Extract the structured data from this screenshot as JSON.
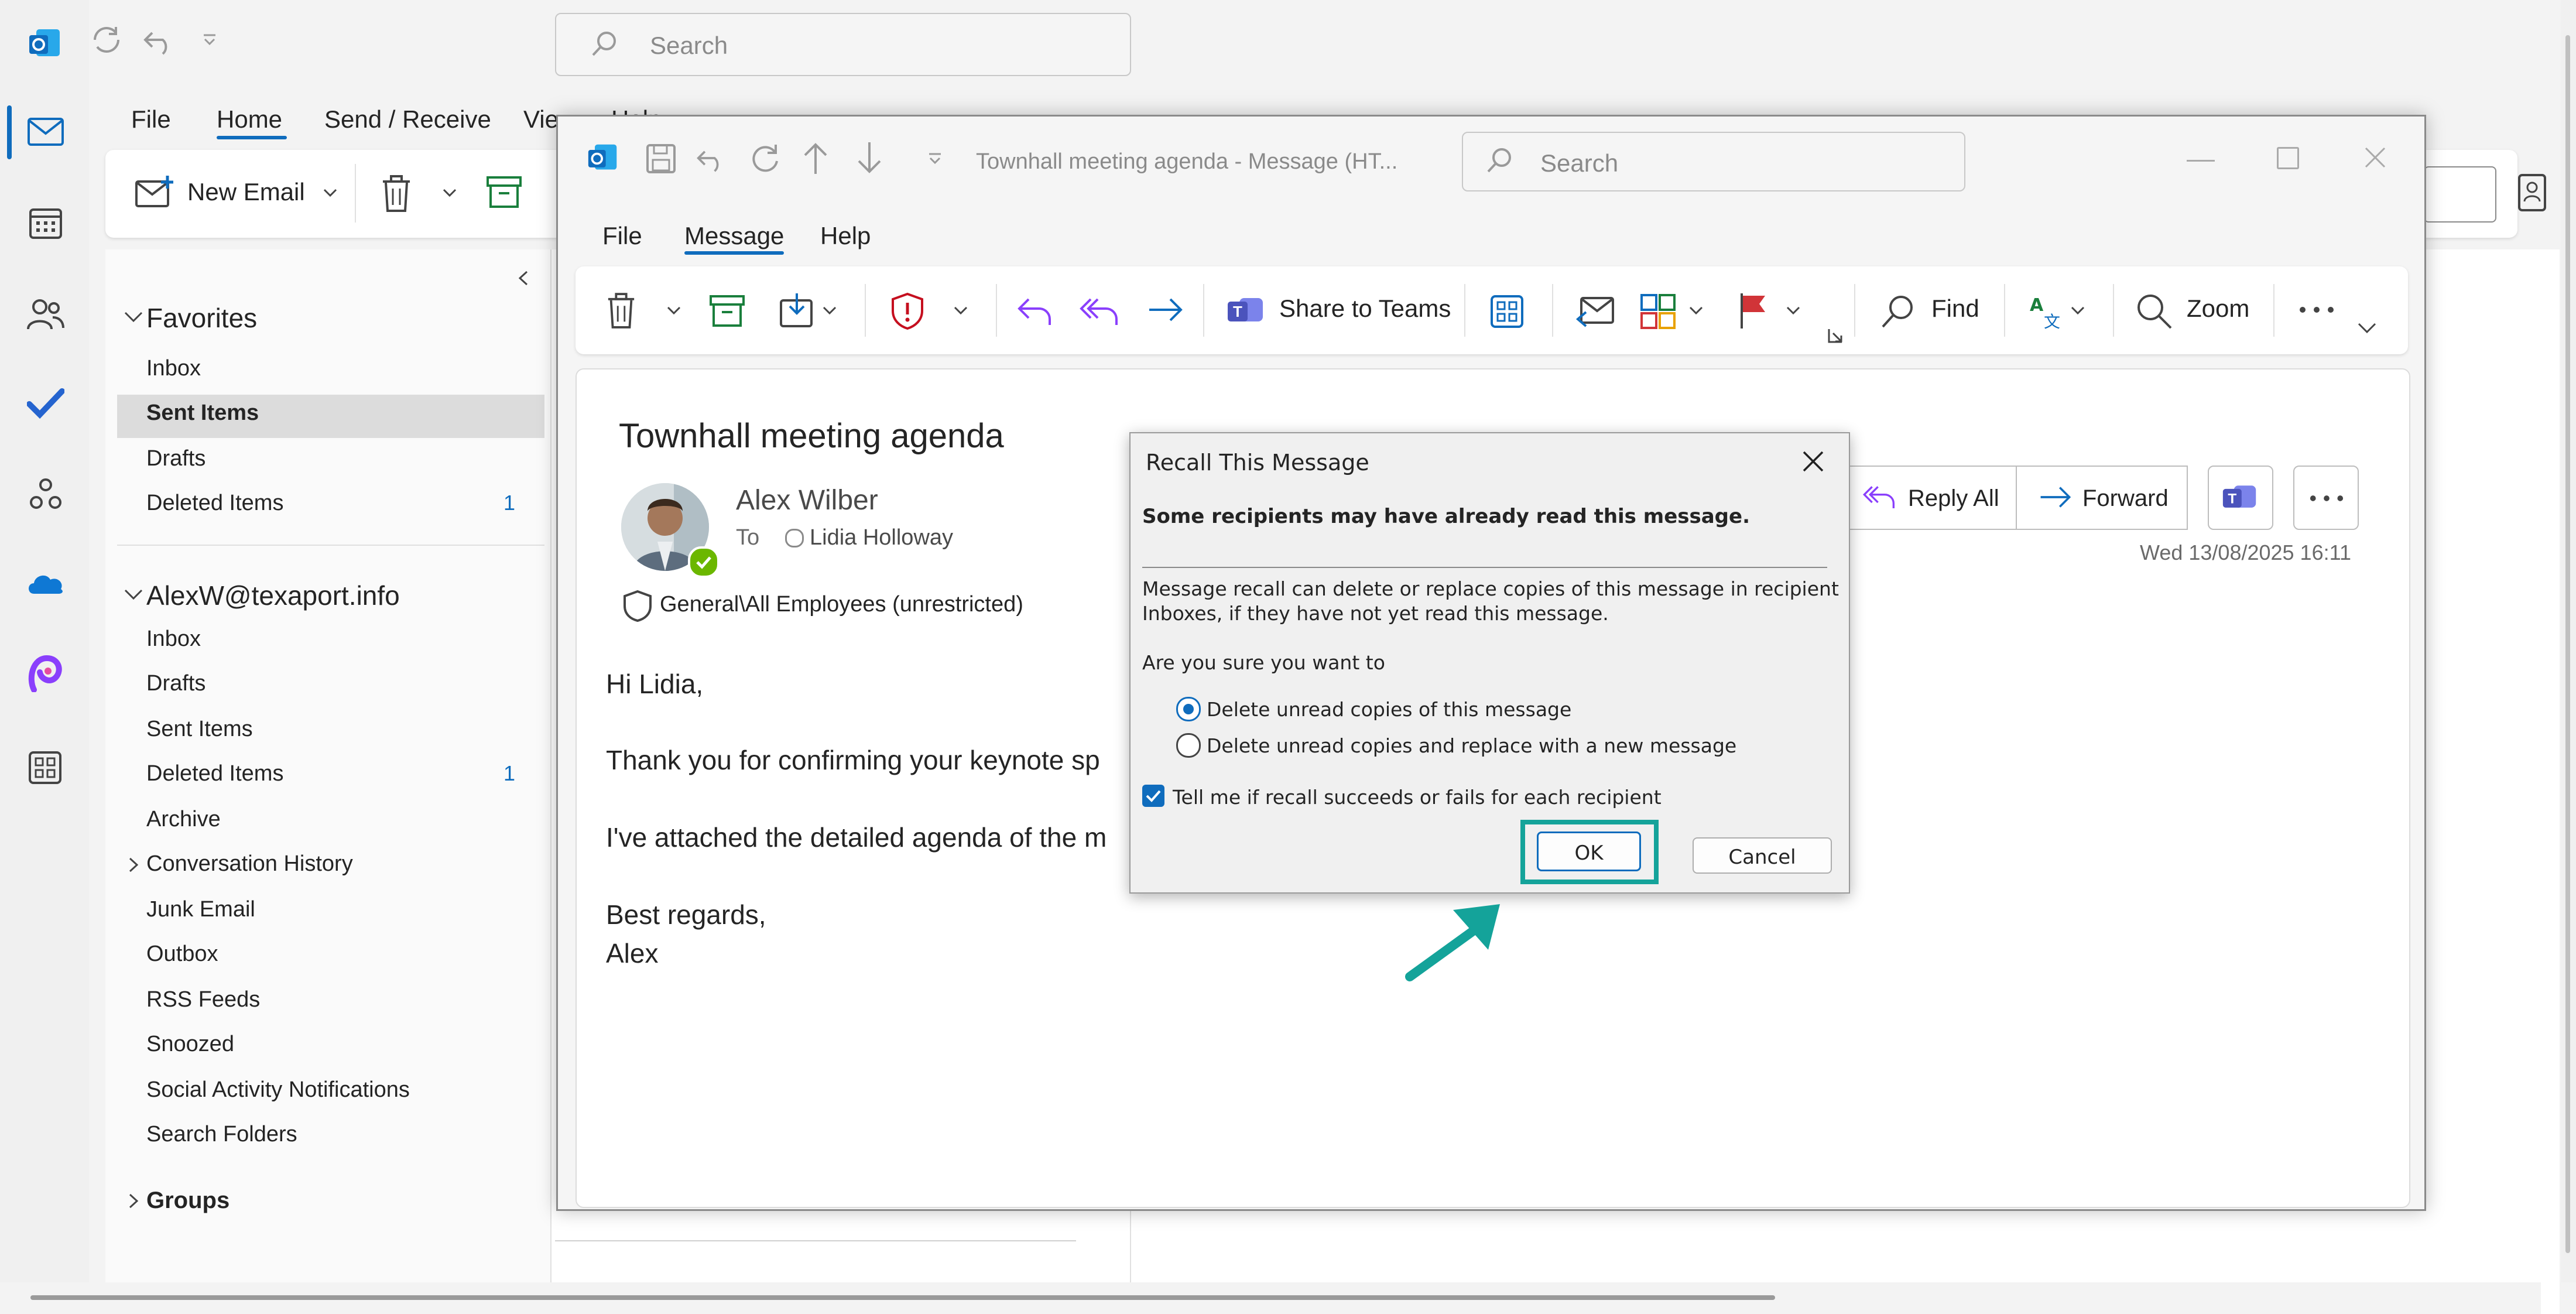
{
  "main_window": {
    "search_placeholder": "Search",
    "tabs": [
      "File",
      "Home",
      "Send / Receive",
      "View",
      "Help"
    ],
    "active_tab": "Home",
    "new_email_label": "New Email"
  },
  "folders": {
    "favorites_header": "Favorites",
    "favorites": [
      {
        "label": "Inbox",
        "count": ""
      },
      {
        "label": "Sent Items",
        "count": ""
      },
      {
        "label": "Drafts",
        "count": ""
      },
      {
        "label": "Deleted Items",
        "count": "1"
      }
    ],
    "account_header": "AlexW@texaport.info",
    "account_folders": [
      {
        "label": "Inbox",
        "count": ""
      },
      {
        "label": "Drafts",
        "count": ""
      },
      {
        "label": "Sent Items",
        "count": ""
      },
      {
        "label": "Deleted Items",
        "count": "1"
      },
      {
        "label": "Archive",
        "count": ""
      },
      {
        "label": "Conversation History",
        "count": ""
      },
      {
        "label": "Junk Email",
        "count": ""
      },
      {
        "label": "Outbox",
        "count": ""
      },
      {
        "label": "RSS Feeds",
        "count": ""
      },
      {
        "label": "Snoozed",
        "count": ""
      },
      {
        "label": "Social Activity Notifications",
        "count": ""
      },
      {
        "label": "Search Folders",
        "count": ""
      }
    ],
    "groups_header": "Groups"
  },
  "message_window": {
    "title": "Townhall meeting agenda  -  Message (HT...",
    "search_placeholder": "Search",
    "tabs": [
      "File",
      "Message",
      "Help"
    ],
    "active_tab": "Message",
    "ribbon": {
      "share_teams": "Share to Teams",
      "find": "Find",
      "zoom": "Zoom"
    },
    "subject": "Townhall meeting agenda",
    "sender": "Alex Wilber",
    "to_label": "To",
    "recipient": "Lidia Holloway",
    "sensitivity": "General\\All Employees (unrestricted)",
    "date": "Wed 13/08/2025 16:11",
    "reply_all": "Reply All",
    "forward": "Forward",
    "body": {
      "greeting": "Hi Lidia,",
      "line1": "Thank you for confirming your keynote sp",
      "line2": "I've attached the detailed agenda of the m",
      "closing": "Best regards,",
      "signature": "Alex"
    }
  },
  "dialog": {
    "title": "Recall This Message",
    "warning": "Some recipients may have already read this message.",
    "description_line1": "Message recall can delete or replace copies of this message in recipient",
    "description_line2": "Inboxes, if they have not yet read this message.",
    "question": "Are you sure you want to",
    "option1": "Delete unread copies of this message",
    "option2": "Delete unread copies and replace with a new message",
    "selected_option": 1,
    "checkbox_label": "Tell me if recall succeeds or fails for each recipient",
    "checkbox_checked": true,
    "ok": "OK",
    "cancel": "Cancel"
  },
  "colors": {
    "accent": "#0f6cbd",
    "highlight_box": "#14a39a",
    "flag": "#d13438",
    "shield": "#c50f1f"
  }
}
